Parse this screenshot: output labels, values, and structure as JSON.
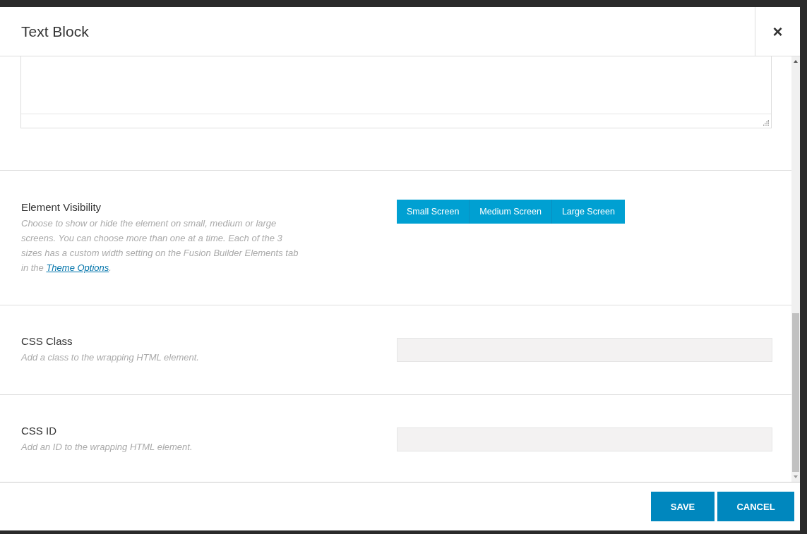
{
  "modal": {
    "title": "Text Block",
    "close": "×"
  },
  "fields": [
    {
      "kind": "visibility",
      "label": "Element Visibility",
      "description": "Choose to show or hide the element on small, medium or large screens. You can choose more than one at a time. Each of the 3 sizes has a custom width setting on the Fusion Builder Elements tab in the ",
      "link": "Theme Options",
      "after_link": ".",
      "options": [
        {
          "label": "Small Screen",
          "selected": true
        },
        {
          "label": "Medium Screen",
          "selected": true
        },
        {
          "label": "Large Screen",
          "selected": true
        }
      ]
    },
    {
      "kind": "text",
      "label": "CSS Class",
      "description": "Add a class to the wrapping HTML element."
    },
    {
      "kind": "text",
      "label": "CSS ID",
      "description": "Add an ID to the wrapping HTML element."
    }
  ],
  "buttons": [
    "SAVE",
    "CANCEL"
  ]
}
